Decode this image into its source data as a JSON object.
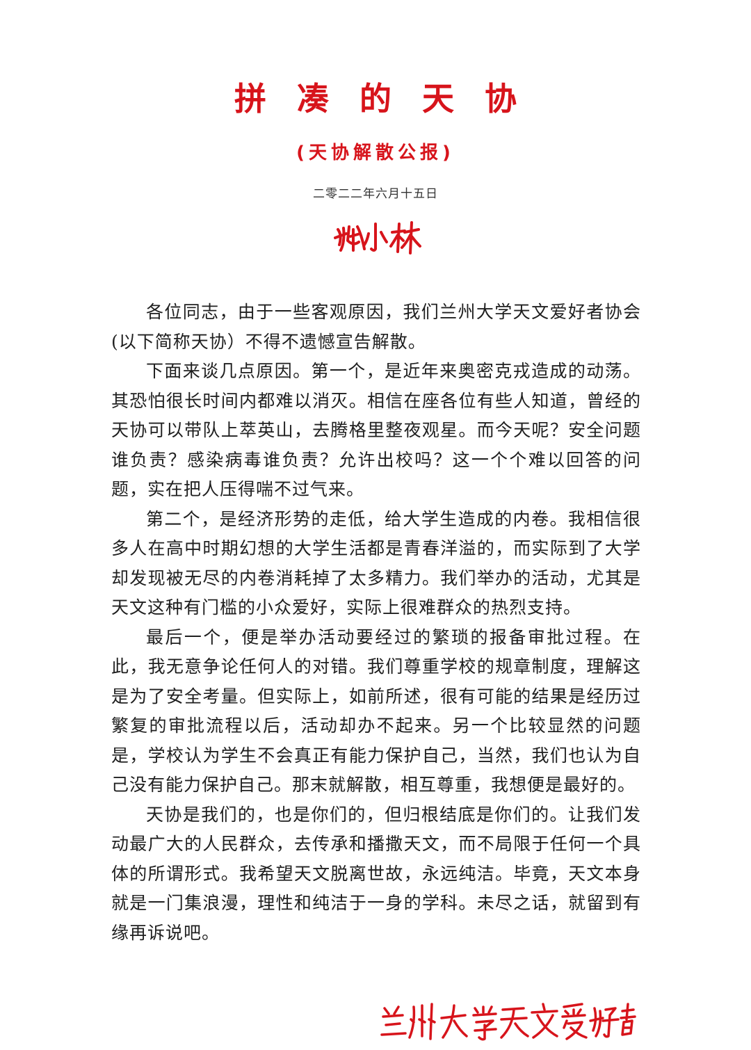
{
  "document": {
    "title": "拼凑的天协",
    "subtitle": "(天协解散公报)",
    "date": "二零二二年六月十五日",
    "signature": "姚小林",
    "organization_signature": "兰州大学天文爱好者协会",
    "accent_color": "#d7141b",
    "paragraphs": [
      "各位同志，由于一些客观原因，我们兰州大学天文爱好者协会(以下简称天协）不得不遗憾宣告解散。",
      "下面来谈几点原因。第一个，是近年来奥密克戎造成的动荡。其恐怕很长时间内都难以消灭。相信在座各位有些人知道，曾经的天协可以带队上萃英山，去腾格里整夜观星。而今天呢？安全问题谁负责？感染病毒谁负责？允许出校吗？这一个个难以回答的问题，实在把人压得喘不过气来。",
      "第二个，是经济形势的走低，给大学生造成的内卷。我相信很多人在高中时期幻想的大学生活都是青春洋溢的，而实际到了大学却发现被无尽的内卷消耗掉了太多精力。我们举办的活动，尤其是天文这种有门槛的小众爱好，实际上很难群众的热烈支持。",
      "最后一个，便是举办活动要经过的繁琐的报备审批过程。在此，我无意争论任何人的对错。我们尊重学校的规章制度，理解这是为了安全考量。但实际上，如前所述，很有可能的结果是经历过繁复的审批流程以后，活动却办不起来。另一个比较显然的问题是，学校认为学生不会真正有能力保护自己，当然，我们也认为自己没有能力保护自己。那末就解散，相互尊重，我想便是最好的。",
      "天协是我们的，也是你们的，但归根结底是你们的。让我们发动最广大的人民群众，去传承和播撒天文，而不局限于任何一个具体的所谓形式。我希望天文脱离世故，永远纯洁。毕竟，天文本身就是一门集浪漫，理性和纯洁于一身的学科。未尽之话，就留到有缘再诉说吧。"
    ]
  }
}
